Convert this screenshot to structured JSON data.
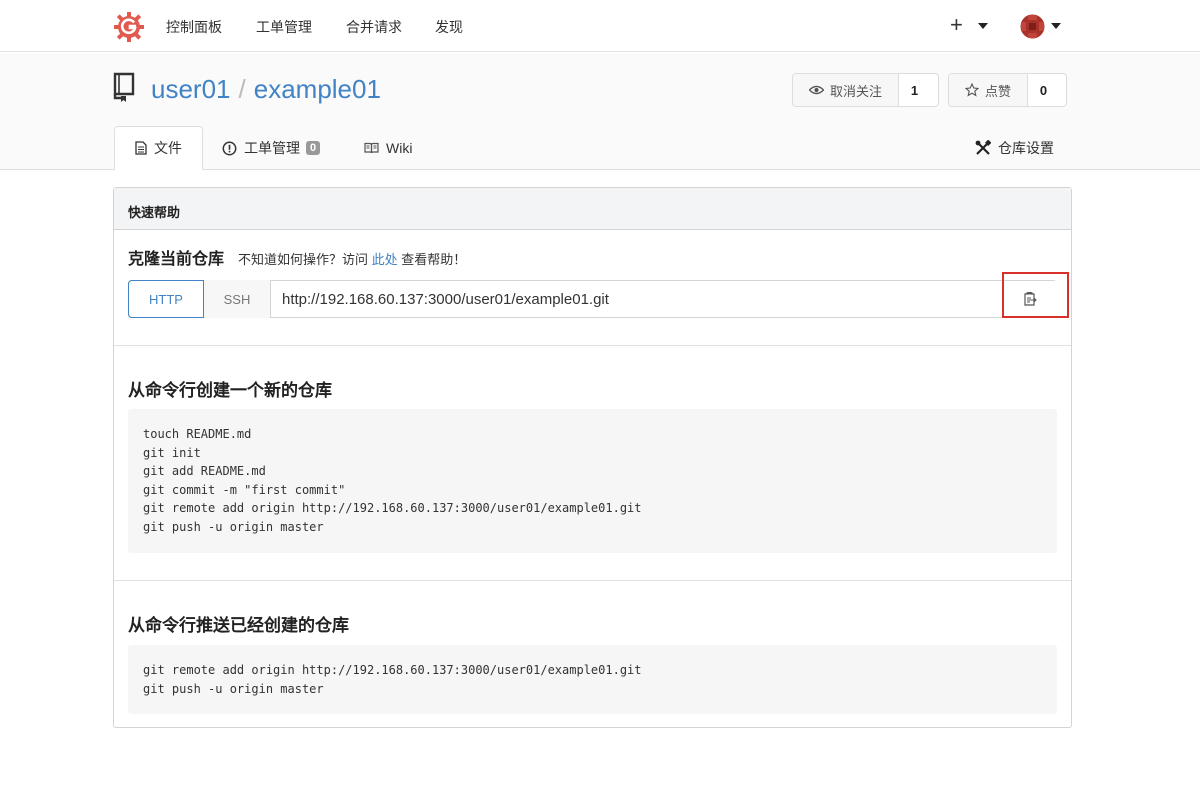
{
  "nav": {
    "items": [
      "控制面板",
      "工单管理",
      "合并请求",
      "发现"
    ],
    "plus_label": "+"
  },
  "repo": {
    "owner": "user01",
    "separator": "/",
    "name": "example01",
    "unwatch_label": "取消关注",
    "watch_count": "1",
    "star_label": "点赞",
    "star_count": "0"
  },
  "tabs": {
    "files": "文件",
    "issues": "工单管理",
    "issues_count": "0",
    "wiki": "Wiki",
    "settings": "仓库设置"
  },
  "quickstart": {
    "header": "快速帮助",
    "clone_title": "克隆当前仓库",
    "help_prefix": "不知道如何操作？访问",
    "help_link": "此处",
    "help_suffix": "查看帮助！",
    "http_label": "HTTP",
    "ssh_label": "SSH",
    "clone_url": "http://192.168.60.137:3000/user01/example01.git",
    "new_repo_title": "从命令行创建一个新的仓库",
    "new_repo_code": "touch README.md\ngit init\ngit add README.md\ngit commit -m \"first commit\"\ngit remote add origin http://192.168.60.137:3000/user01/example01.git\ngit push -u origin master",
    "push_repo_title": "从命令行推送已经创建的仓库",
    "push_repo_code": "git remote add origin http://192.168.60.137:3000/user01/example01.git\ngit push -u origin master"
  },
  "colors": {
    "link": "#4183c4",
    "brand": "#e05a4f",
    "highlight": "#d9302c"
  }
}
